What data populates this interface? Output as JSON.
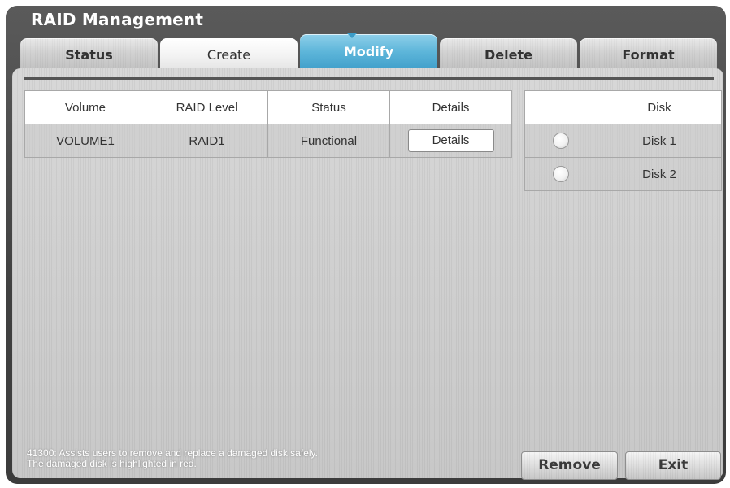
{
  "window": {
    "title": "RAID Management"
  },
  "tabs": [
    {
      "label": "Status"
    },
    {
      "label": "Create"
    },
    {
      "label": "Modify",
      "active": true
    },
    {
      "label": "Delete"
    },
    {
      "label": "Format"
    }
  ],
  "volume_table": {
    "headers": [
      "Volume",
      "RAID Level",
      "Status",
      "Details"
    ],
    "rows": [
      {
        "volume": "VOLUME1",
        "raid_level": "RAID1",
        "status": "Functional",
        "details_button": "Details"
      }
    ]
  },
  "disk_table": {
    "headers": [
      "",
      "Disk"
    ],
    "rows": [
      {
        "disk": "Disk 1",
        "selected": false
      },
      {
        "disk": "Disk 2",
        "selected": false
      }
    ]
  },
  "help": {
    "line1": "41300: Assists users to remove and replace a damaged disk safely.",
    "line2": "The damaged disk is highlighted in red."
  },
  "buttons": {
    "remove": "Remove",
    "exit": "Exit"
  },
  "colors": {
    "active_tab": "#5eb6da",
    "window_bg": "#4a4a4a",
    "panel_bg": "#cfcfcf"
  }
}
